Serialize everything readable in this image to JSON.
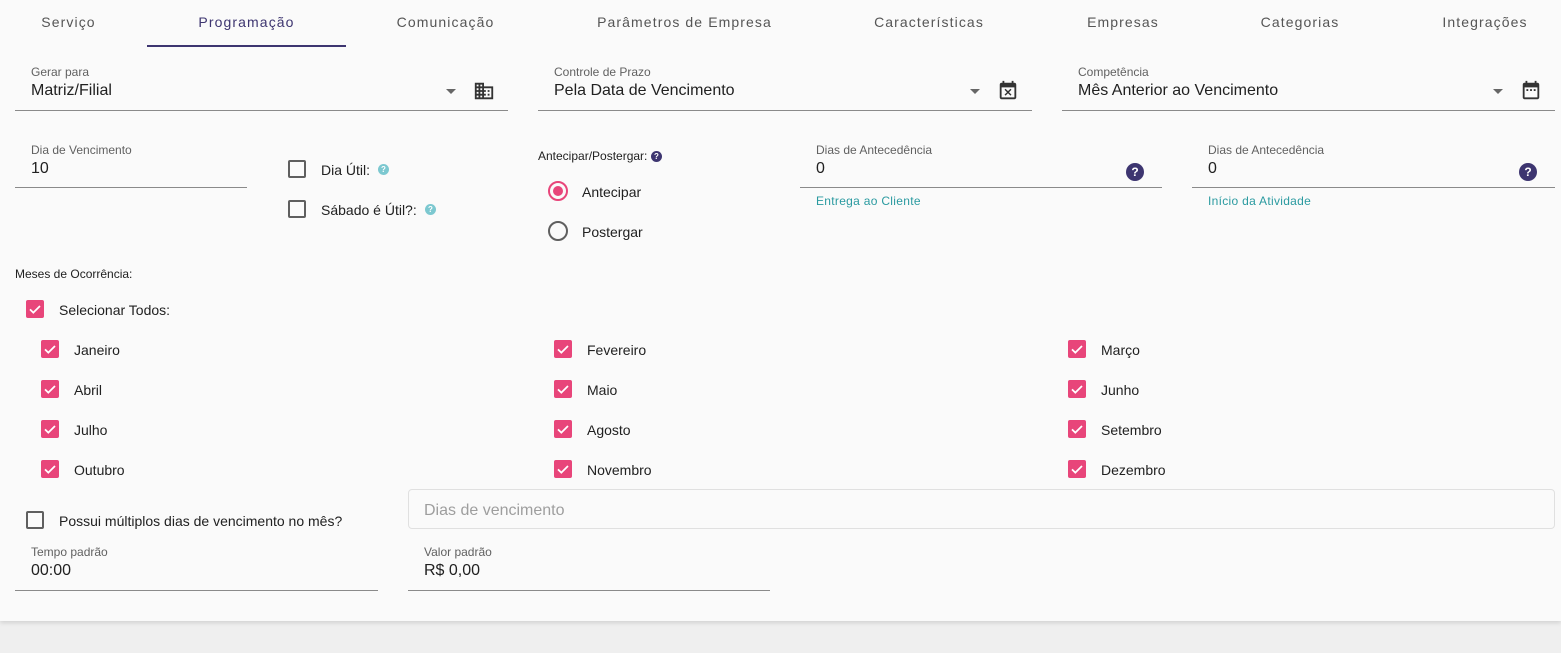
{
  "tabs": [
    {
      "label": "Serviço"
    },
    {
      "label": "Programação"
    },
    {
      "label": "Comunicação"
    },
    {
      "label": "Parâmetros de Empresa"
    },
    {
      "label": "Características"
    },
    {
      "label": "Empresas"
    },
    {
      "label": "Categorias"
    },
    {
      "label": "Integrações"
    }
  ],
  "active_tab": "Programação",
  "gerar_para": {
    "label": "Gerar para",
    "value": "Matriz/Filial",
    "icon": "building-icon"
  },
  "controle_prazo": {
    "label": "Controle de Prazo",
    "value": "Pela Data de Vencimento",
    "icon": "calendar-remove-icon"
  },
  "competencia": {
    "label": "Competência",
    "value": "Mês Anterior ao Vencimento",
    "icon": "calendar-icon"
  },
  "dia_vencimento": {
    "label": "Dia de Vencimento",
    "value": "10"
  },
  "dia_util": {
    "label": "Dia Útil:",
    "checked": false
  },
  "sabado_util": {
    "label": "Sábado é Útil?:",
    "checked": false
  },
  "antecipar_postergar": {
    "label": "Antecipar/Postergar:",
    "options": [
      {
        "label": "Antecipar",
        "selected": true
      },
      {
        "label": "Postergar",
        "selected": false
      }
    ]
  },
  "antecedencia_entrega": {
    "label": "Dias de Antecedência",
    "value": "0",
    "hint": "Entrega ao Cliente"
  },
  "antecedencia_inicio": {
    "label": "Dias de Antecedência",
    "value": "0",
    "hint": "Início da Atividade"
  },
  "meses": {
    "label": "Meses de Ocorrência:",
    "select_all": {
      "label": "Selecionar Todos:",
      "checked": true
    },
    "items": [
      {
        "label": "Janeiro",
        "checked": true
      },
      {
        "label": "Fevereiro",
        "checked": true
      },
      {
        "label": "Março",
        "checked": true
      },
      {
        "label": "Abril",
        "checked": true
      },
      {
        "label": "Maio",
        "checked": true
      },
      {
        "label": "Junho",
        "checked": true
      },
      {
        "label": "Julho",
        "checked": true
      },
      {
        "label": "Agosto",
        "checked": true
      },
      {
        "label": "Setembro",
        "checked": true
      },
      {
        "label": "Outubro",
        "checked": true
      },
      {
        "label": "Novembro",
        "checked": true
      },
      {
        "label": "Dezembro",
        "checked": true
      }
    ]
  },
  "multiplos_dias": {
    "label": "Possui múltiplos dias de vencimento no mês?",
    "checked": false
  },
  "dias_vencimento_input": {
    "placeholder": "Dias de vencimento",
    "value": ""
  },
  "tempo_padrao": {
    "label": "Tempo padrão",
    "value": "00:00"
  },
  "valor_padrao": {
    "label": "Valor padrão",
    "value": "R$ 0,00"
  },
  "colors": {
    "primary": "#3d3570",
    "accent": "#e8457a",
    "hint": "#2a9aa0"
  }
}
